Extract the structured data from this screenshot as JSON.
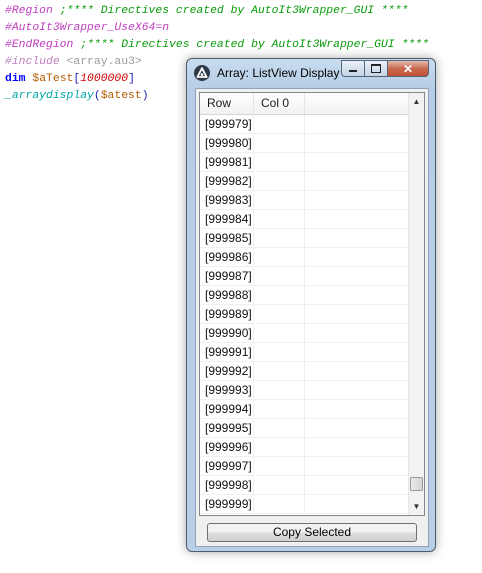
{
  "editor": {
    "line1": {
      "directive": "#Region",
      "comment": " ;**** Directives created by AutoIt3Wrapper_GUI ****"
    },
    "line2": {
      "directive": "#AutoIt3Wrapper_UseX64=n"
    },
    "line3": {
      "directive": "#EndRegion",
      "comment": " ;**** Directives created by AutoIt3Wrapper_GUI ****"
    },
    "line4": {
      "directive": "#include",
      "path": " <array.au3>"
    },
    "line5": {
      "keyword": "dim",
      "var": "$aTest",
      "open": "[",
      "number": "1000000",
      "close": "]"
    },
    "line6": {
      "func": "_arraydisplay",
      "open": "(",
      "var": "$atest",
      "close": ")"
    }
  },
  "window": {
    "title": "Array: ListView Display",
    "icon": "autoit-icon",
    "controls": {
      "minimize": "minimize-icon",
      "maximize": "maximize-icon",
      "close": "close-icon"
    }
  },
  "listview": {
    "columns": [
      "Row",
      "Col 0"
    ],
    "rows": [
      [
        "[999979]",
        ""
      ],
      [
        "[999980]",
        ""
      ],
      [
        "[999981]",
        ""
      ],
      [
        "[999982]",
        ""
      ],
      [
        "[999983]",
        ""
      ],
      [
        "[999984]",
        ""
      ],
      [
        "[999985]",
        ""
      ],
      [
        "[999986]",
        ""
      ],
      [
        "[999987]",
        ""
      ],
      [
        "[999988]",
        ""
      ],
      [
        "[999989]",
        ""
      ],
      [
        "[999990]",
        ""
      ],
      [
        "[999991]",
        ""
      ],
      [
        "[999992]",
        ""
      ],
      [
        "[999993]",
        ""
      ],
      [
        "[999994]",
        ""
      ],
      [
        "[999995]",
        ""
      ],
      [
        "[999996]",
        ""
      ],
      [
        "[999997]",
        ""
      ],
      [
        "[999998]",
        ""
      ],
      [
        "[999999]",
        ""
      ]
    ],
    "scroll_position": 1.0
  },
  "buttons": {
    "copy_selected": "Copy Selected"
  },
  "colors": {
    "directive": "#c13ec1",
    "comment": "#0a9b0a",
    "keyword": "#0000ff",
    "variable": "#b65c00",
    "number": "#d00000",
    "function": "#00a5a5",
    "close_button": "#c25035"
  }
}
